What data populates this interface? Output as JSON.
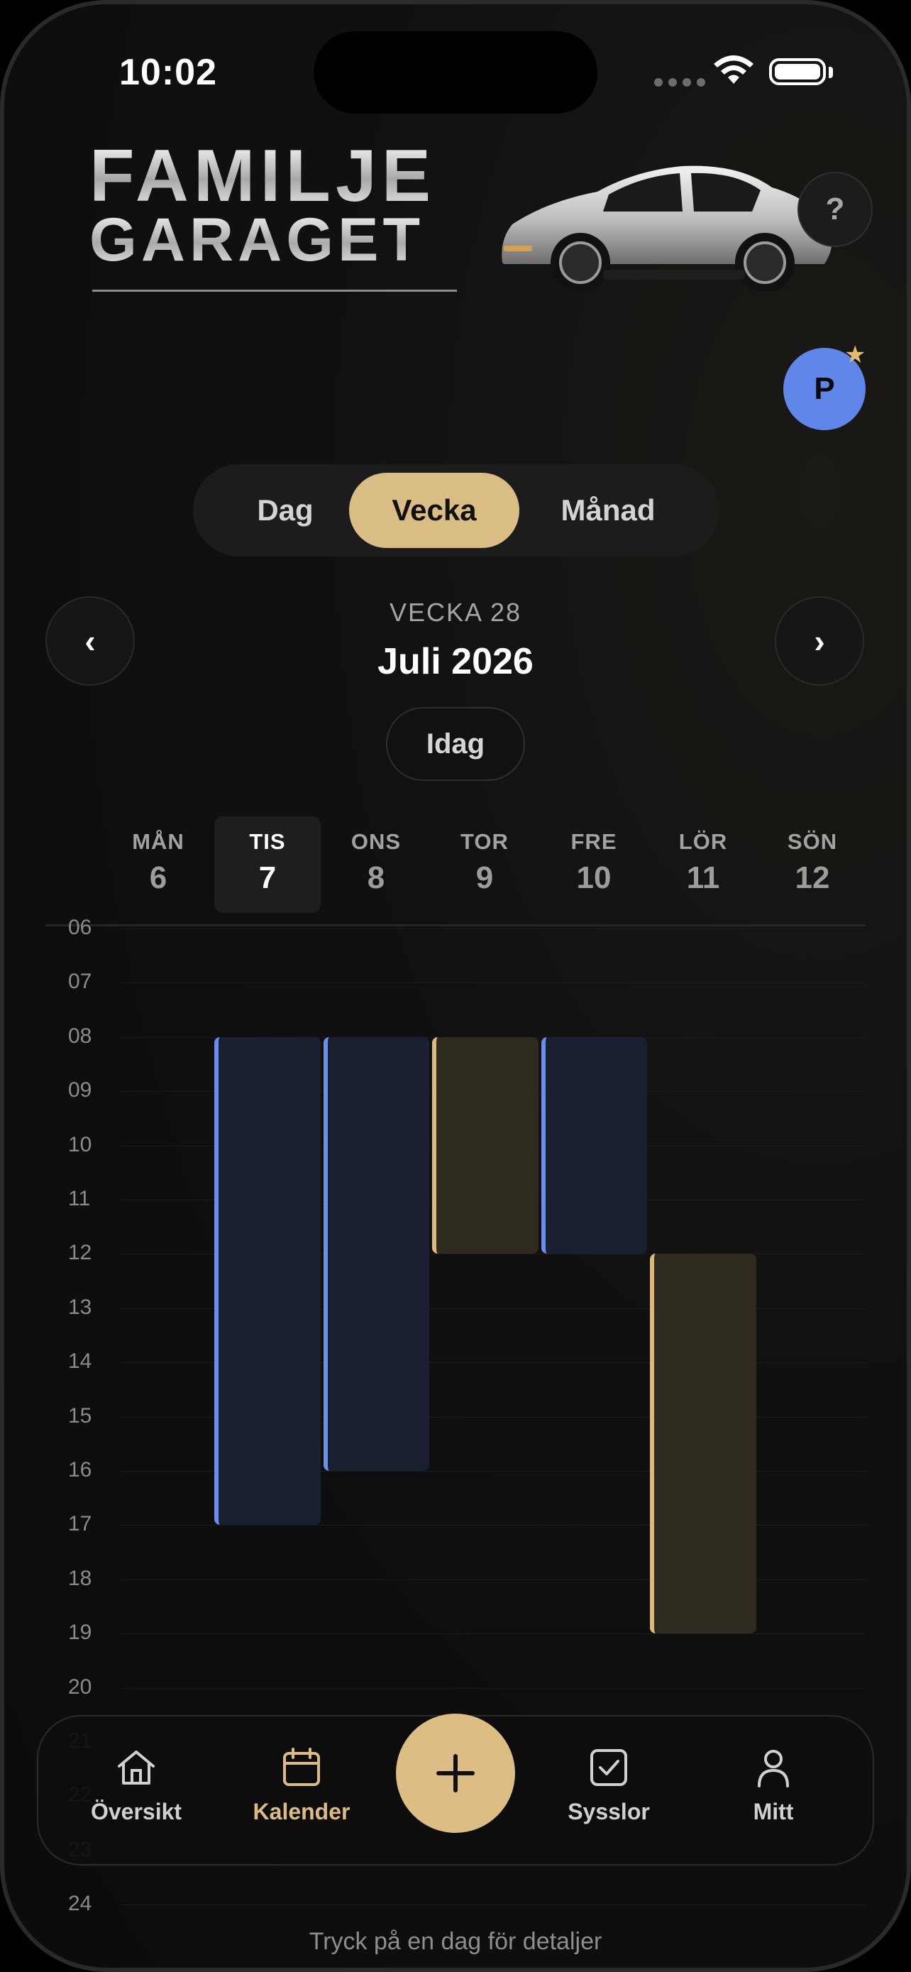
{
  "status_bar": {
    "time": "10:02"
  },
  "header": {
    "logo_line1": "FAMILJE",
    "logo_line2": "GARAGET",
    "help_label": "?",
    "avatar_initial": "P",
    "avatar_star": "★"
  },
  "view_switch": {
    "items": [
      {
        "label": "Dag",
        "active": false
      },
      {
        "label": "Vecka",
        "active": true
      },
      {
        "label": "Månad",
        "active": false
      }
    ]
  },
  "week_nav": {
    "prev_label": "‹",
    "next_label": "›",
    "week_label": "VECKA 28",
    "month_label": "Juli 2026",
    "today_label": "Idag"
  },
  "days": [
    {
      "name": "MÅN",
      "date": "6",
      "selected": false
    },
    {
      "name": "TIS",
      "date": "7",
      "selected": true
    },
    {
      "name": "ONS",
      "date": "8",
      "selected": false
    },
    {
      "name": "TOR",
      "date": "9",
      "selected": false
    },
    {
      "name": "FRE",
      "date": "10",
      "selected": false
    },
    {
      "name": "LÖR",
      "date": "11",
      "selected": false
    },
    {
      "name": "SÖN",
      "date": "12",
      "selected": false
    }
  ],
  "hours": [
    "06",
    "07",
    "08",
    "09",
    "10",
    "11",
    "12",
    "13",
    "14",
    "15",
    "16",
    "17",
    "18",
    "19",
    "20",
    "21",
    "22",
    "23",
    "24"
  ],
  "events": [
    {
      "day": "TIS",
      "start": 8,
      "end": 17,
      "color": "blue"
    },
    {
      "day": "ONS",
      "start": 8,
      "end": 16,
      "color": "blue"
    },
    {
      "day": "TOR",
      "start": 8,
      "end": 12,
      "color": "gold"
    },
    {
      "day": "FRE",
      "start": 8,
      "end": 12,
      "color": "blue"
    },
    {
      "day": "LÖR",
      "start": 12,
      "end": 19,
      "color": "gold"
    }
  ],
  "tab_bar": {
    "tabs": [
      {
        "label": "Översikt",
        "icon": "home-icon",
        "active": false
      },
      {
        "label": "Kalender",
        "icon": "calendar-icon",
        "active": true
      },
      {
        "label": "Sysslor",
        "icon": "checkbox-icon",
        "active": false
      },
      {
        "label": "Mitt",
        "icon": "person-icon",
        "active": false
      }
    ],
    "fab_icon": "plus-icon"
  },
  "footer_hint": "Tryck på en dag för detaljer",
  "colors": {
    "accent_gold": "#dcbd83",
    "event_blue": "#6a8ef0",
    "avatar_blue": "#5f86e8",
    "background": "#0e0e0e"
  }
}
